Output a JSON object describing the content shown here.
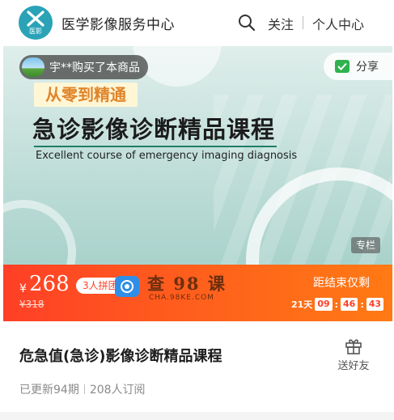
{
  "header": {
    "logo_text": "医影",
    "brand_name": "医学影像服务中心",
    "search_icon": "search-icon",
    "follow_label": "关注",
    "profile_label": "个人中心"
  },
  "banner": {
    "buyer_notice": "宇**购买了本商品",
    "share_label": "分享",
    "ribbon": "从零到精通",
    "title_cn": "急诊影像诊断精品课程",
    "title_en": "Excellent course of emergency imaging diagnosis",
    "tag": "专栏"
  },
  "price": {
    "currency": "¥",
    "current": "268",
    "original": "¥318",
    "group_badge": "3人拼团",
    "countdown_label": "距结束仅剩",
    "days": "21天",
    "hours": "09",
    "minutes": "46",
    "seconds": "43",
    "colors": {
      "bar_start": "#ff3f27",
      "bar_end": "#ff7a14"
    }
  },
  "watermark": {
    "title": "查 98 课",
    "url": "CHA.98KE.COM"
  },
  "course": {
    "title": "危急值(急诊)影像诊断精品课程",
    "gift_label": "送好友",
    "updated": "已更新94期",
    "subscribers": "208人订阅"
  }
}
